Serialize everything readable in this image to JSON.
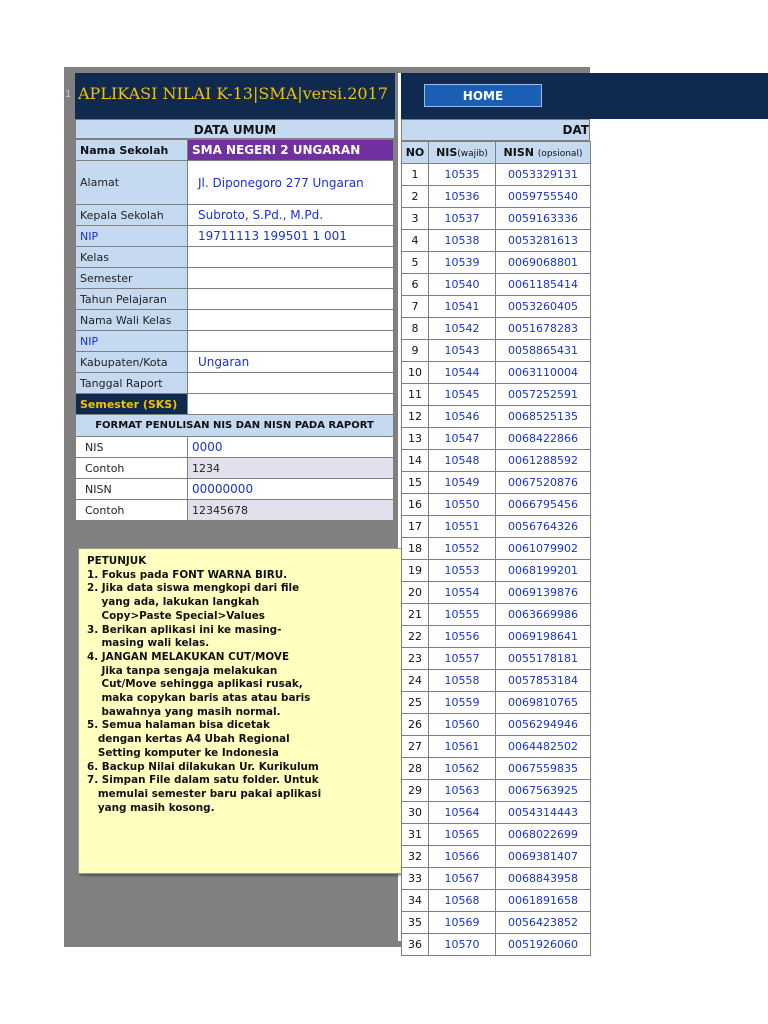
{
  "header": {
    "row_number": "1",
    "app_title": "APLIKASI NILAI K-13|SMA|versi.2017",
    "home_button": "HOME"
  },
  "data_umum": {
    "title": "DATA UMUM",
    "school_label": "Nama Sekolah",
    "school_value": "SMA NEGERI 2 UNGARAN",
    "fields": [
      {
        "label": "Alamat",
        "value": "Jl. Diponegoro 277 Ungaran"
      },
      {
        "label": "Kepala Sekolah",
        "value": "Subroto, S.Pd., M.Pd."
      },
      {
        "label": "NIP",
        "value": "19711113 199501 1 001"
      },
      {
        "label": "Kelas",
        "value": ""
      },
      {
        "label": "Semester",
        "value": ""
      },
      {
        "label": "Tahun Pelajaran",
        "value": ""
      },
      {
        "label": "Nama Wali Kelas",
        "value": ""
      },
      {
        "label": "NIP",
        "value": ""
      },
      {
        "label": "Kabupaten/Kota",
        "value": "Ungaran"
      },
      {
        "label": "Tanggal Raport",
        "value": ""
      }
    ],
    "semester_sks_label": "Semester (SKS)",
    "semester_sks_value": ""
  },
  "format": {
    "title": "FORMAT PENULISAN NIS DAN NISN PADA RAPORT",
    "rows": [
      {
        "label": "NIS",
        "value": "0000"
      },
      {
        "label": "Contoh",
        "value": "1234"
      },
      {
        "label": "NISN",
        "value": "00000000"
      },
      {
        "label": "Contoh",
        "value": "12345678"
      }
    ]
  },
  "petunjuk": [
    "PETUNJUK",
    "1. Fokus pada FONT WARNA BIRU.",
    "2. Jika data siswa mengkopi dari file",
    "    yang ada, lakukan langkah",
    "    Copy>Paste Special>Values",
    "3. Berikan aplikasi ini ke masing-",
    "    masing wali kelas.",
    "4. JANGAN MELAKUKAN CUT/MOVE",
    "    Jika tanpa sengaja melakukan",
    "    Cut/Move sehingga aplikasi rusak,",
    "    maka copykan baris atas atau baris",
    "    bawahnya yang masih normal.",
    "5. Semua halaman bisa dicetak",
    "   dengan kertas A4 Ubah Regional",
    "   Setting komputer ke Indonesia",
    "6. Backup Nilai dilakukan Ur. Kurikulum",
    "7. Simpan File dalam satu folder. Untuk",
    "   memulai semester baru pakai aplikasi",
    "   yang masih kosong."
  ],
  "siswa": {
    "title": "DAT",
    "col_no": "NO",
    "col_nis": "NIS",
    "col_nis_note": "(wajib)",
    "col_nisn": "NISN",
    "col_nisn_note": "(opsional)",
    "rows": [
      [
        "1",
        "10535",
        "0053329131"
      ],
      [
        "2",
        "10536",
        "0059755540"
      ],
      [
        "3",
        "10537",
        "0059163336"
      ],
      [
        "4",
        "10538",
        "0053281613"
      ],
      [
        "5",
        "10539",
        "0069068801"
      ],
      [
        "6",
        "10540",
        "0061185414"
      ],
      [
        "7",
        "10541",
        "0053260405"
      ],
      [
        "8",
        "10542",
        "0051678283"
      ],
      [
        "9",
        "10543",
        "0058865431"
      ],
      [
        "10",
        "10544",
        "0063110004"
      ],
      [
        "11",
        "10545",
        "0057252591"
      ],
      [
        "12",
        "10546",
        "0068525135"
      ],
      [
        "13",
        "10547",
        "0068422866"
      ],
      [
        "14",
        "10548",
        "0061288592"
      ],
      [
        "15",
        "10549",
        "0067520876"
      ],
      [
        "16",
        "10550",
        "0066795456"
      ],
      [
        "17",
        "10551",
        "0056764326"
      ],
      [
        "18",
        "10552",
        "0061079902"
      ],
      [
        "19",
        "10553",
        "0068199201"
      ],
      [
        "20",
        "10554",
        "0069139876"
      ],
      [
        "21",
        "10555",
        "0063669986"
      ],
      [
        "22",
        "10556",
        "0069198641"
      ],
      [
        "23",
        "10557",
        "0055178181"
      ],
      [
        "24",
        "10558",
        "0057853184"
      ],
      [
        "25",
        "10559",
        "0069810765"
      ],
      [
        "26",
        "10560",
        "0056294946"
      ],
      [
        "27",
        "10561",
        "0064482502"
      ],
      [
        "28",
        "10562",
        "0067559835"
      ],
      [
        "29",
        "10563",
        "0067563925"
      ],
      [
        "30",
        "10564",
        "0054314443"
      ],
      [
        "31",
        "10565",
        "0068022699"
      ],
      [
        "32",
        "10566",
        "0069381407"
      ],
      [
        "33",
        "10567",
        "0068843958"
      ],
      [
        "34",
        "10568",
        "0061891658"
      ],
      [
        "35",
        "10569",
        "0056423852"
      ],
      [
        "36",
        "10570",
        "0051926060"
      ]
    ]
  }
}
